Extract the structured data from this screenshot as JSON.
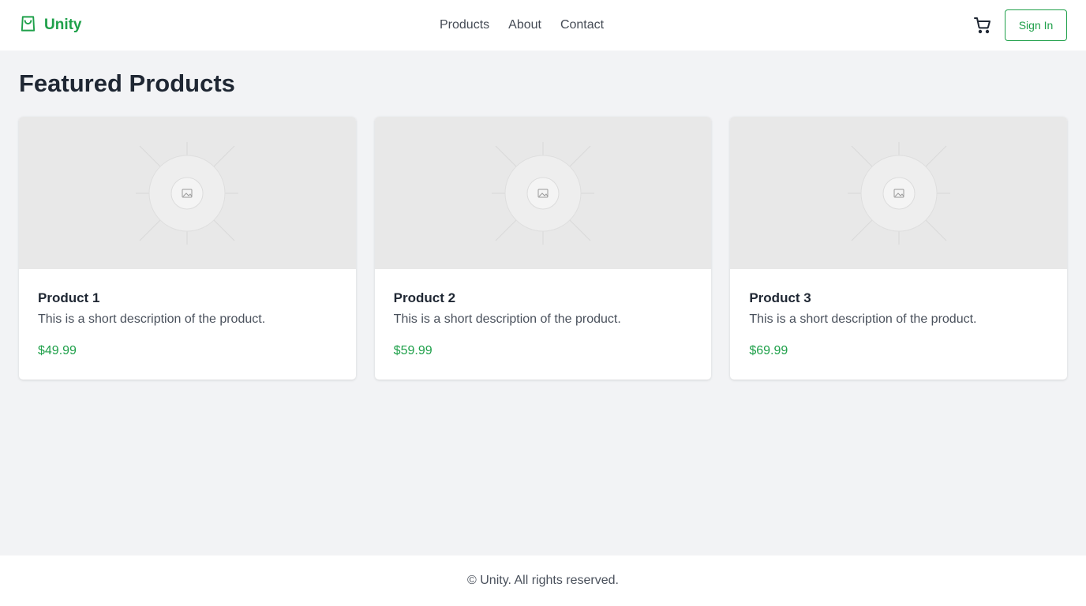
{
  "header": {
    "brand": "Unity",
    "nav": [
      "Products",
      "About",
      "Contact"
    ],
    "sign_in": "Sign In",
    "icons": {
      "logo": "shopping-bag-icon",
      "cart": "cart-icon"
    },
    "accent_color": "#1fa04a"
  },
  "main": {
    "title": "Featured Products",
    "products": [
      {
        "name": "Product 1",
        "description": "This is a short description of the product.",
        "price": "$49.99"
      },
      {
        "name": "Product 2",
        "description": "This is a short description of the product.",
        "price": "$59.99"
      },
      {
        "name": "Product 3",
        "description": "This is a short description of the product.",
        "price": "$69.99"
      }
    ]
  },
  "footer": {
    "text": "© Unity. All rights reserved."
  }
}
